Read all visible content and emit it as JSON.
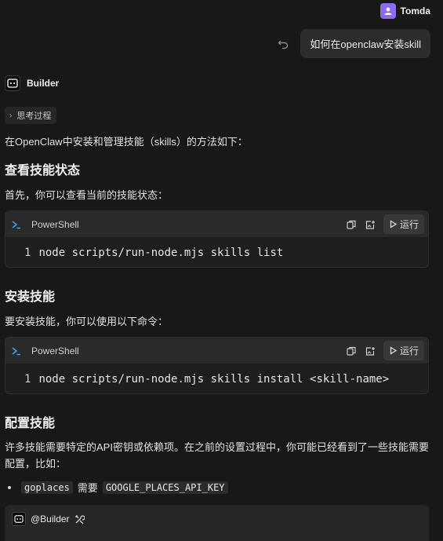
{
  "user": {
    "name": "Tomda",
    "message": "如何在openclaw安装skill"
  },
  "bot": {
    "name": "Builder"
  },
  "thinking": {
    "label": "思考过程"
  },
  "intro": "在OpenClaw中安装和管理技能（skills）的方法如下：",
  "sections": [
    {
      "title": "查看技能状态",
      "text": "首先，你可以查看当前的技能状态：",
      "code": {
        "lang": "PowerShell",
        "line": "1",
        "command": "node scripts/run-node.mjs skills list",
        "run_label": "运行"
      }
    },
    {
      "title": "安装技能",
      "text": "要安装技能，你可以使用以下命令：",
      "code": {
        "lang": "PowerShell",
        "line": "1",
        "command": "node scripts/run-node.mjs skills install <skill-name>",
        "run_label": "运行"
      }
    },
    {
      "title": "配置技能",
      "text_line1": "许多技能需要特定的API密钥或依赖项。在之前的设置过程中，你可能已经看到了一些技能需要",
      "text_line2": "配置，比如："
    }
  ],
  "bullet": {
    "code1": "goplaces",
    "word": "需要",
    "code2": "GOOGLE_PLACES_API_KEY"
  },
  "mention": {
    "name": "@Builder"
  },
  "colors": {
    "user_avatar": "#8b6cf0",
    "powershell": "#3aa0e8",
    "background": "#181818"
  },
  "icons": [
    "undo-icon",
    "bot-icon",
    "chevron-right-icon",
    "powershell-icon",
    "copy-icon",
    "insert-icon",
    "play-icon",
    "tools-icon"
  ]
}
